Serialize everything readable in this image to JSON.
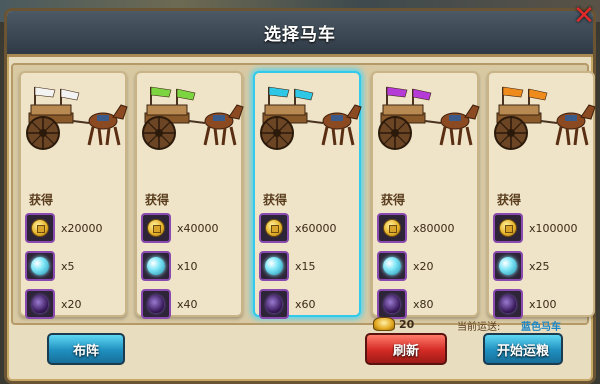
{
  "dialog": {
    "title": "选择马车",
    "close_icon": "close-x-icon"
  },
  "reward_label": "获得",
  "carts": [
    {
      "flag_color": "#f3f3f3",
      "rewards": [
        {
          "icon": "gold-coin-icon",
          "qty": "x20000"
        },
        {
          "icon": "cyan-orb-icon",
          "qty": "x5"
        },
        {
          "icon": "purple-crystal-icon",
          "qty": "x20"
        }
      ]
    },
    {
      "flag_color": "#7cd441",
      "rewards": [
        {
          "icon": "gold-coin-icon",
          "qty": "x40000"
        },
        {
          "icon": "cyan-orb-icon",
          "qty": "x10"
        },
        {
          "icon": "purple-crystal-icon",
          "qty": "x40"
        }
      ]
    },
    {
      "flag_color": "#2ec7e6",
      "selected": true,
      "rewards": [
        {
          "icon": "gold-coin-icon",
          "qty": "x60000"
        },
        {
          "icon": "cyan-orb-icon",
          "qty": "x15"
        },
        {
          "icon": "purple-crystal-icon",
          "qty": "x60"
        }
      ]
    },
    {
      "flag_color": "#b43bd6",
      "rewards": [
        {
          "icon": "gold-coin-icon",
          "qty": "x80000"
        },
        {
          "icon": "cyan-orb-icon",
          "qty": "x20"
        },
        {
          "icon": "purple-crystal-icon",
          "qty": "x80"
        }
      ]
    },
    {
      "flag_color": "#ef8b1d",
      "rewards": [
        {
          "icon": "gold-coin-icon",
          "qty": "x100000"
        },
        {
          "icon": "cyan-orb-icon",
          "qty": "x25"
        },
        {
          "icon": "purple-crystal-icon",
          "qty": "x100"
        }
      ]
    }
  ],
  "footer": {
    "formation_button": "布阵",
    "refresh_button": "刷新",
    "ingot_count": "20",
    "current_label": "当前运送:",
    "current_value": "蓝色马车",
    "start_button": "开始运粮"
  },
  "colors": {
    "selected_border": "#33c9ea",
    "current_value": "#1a86c6"
  }
}
